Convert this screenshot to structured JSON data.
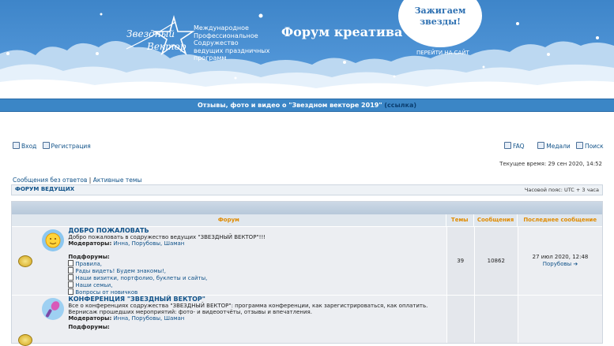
{
  "header": {
    "logo_line1": "Звездный",
    "logo_line2": "Вектор",
    "org_lines": [
      "Международное",
      "Профессиональное",
      "Содружество",
      "ведущих праздничных",
      "программ"
    ],
    "forum_title": "Форум креатива",
    "bubble_line1": "Зажигаем",
    "bubble_line2": "звезды!",
    "goto_site": "ПЕРЕЙТИ НА САЙТ"
  },
  "announcement": {
    "text": "Отзывы, фото и видео о \"Звездном векторе 2019\"",
    "link": "(ссылка)"
  },
  "nav": {
    "login": "Вход",
    "register": "Регистрация",
    "faq": "FAQ",
    "medals": "Медали",
    "search": "Поиск"
  },
  "current_time": "Текущее время: 29 сен 2020, 14:52",
  "links": {
    "unanswered": "Сообщения без ответов",
    "sep": "|",
    "active": "Активные темы"
  },
  "breadcrumb": {
    "forum": "ФОРУМ ВЕДУЩИХ",
    "timezone": "Часовой пояс: UTC + 3 часа"
  },
  "table": {
    "headers": {
      "forum": "Форум",
      "topics": "Темы",
      "posts": "Сообщения",
      "last": "Последнее сообщение"
    },
    "rows": [
      {
        "title": "ДОБРО ПОЖАЛОВАТЬ",
        "desc": "Добро пожаловать в содружество ведущих \"ЗВЕЗДНЫЙ ВЕКТОР\"!!!",
        "mods_label": "Модераторы:",
        "mods": "Инна, Порубовы, Шаман",
        "subforums_label": "Подфорумы:",
        "subforums": [
          "Правила,",
          "Рады видеть! Будем знакомы!,",
          "Наши визитки, портфолио, буклеты и сайты,",
          "Наши семьи,",
          "Вопросы от новичков"
        ],
        "topics": "39",
        "posts": "10862",
        "last_date": "27 июл 2020, 12:48",
        "last_author": "Порубовы"
      },
      {
        "title": "КОНФЕРЕНЦИЯ \"ЗВЕЗДНЫЙ ВЕКТОР\"",
        "desc": "Все о конференциях содружества \"ЗВЕЗДНЫЙ ВЕКТОР\": программа конференции, как зарегистрироваться, как оплатить. Вернисаж прошедших мероприятий: фото- и видеоотчёты, отзывы и впечатления.",
        "mods_label": "Модераторы:",
        "mods": "Инна, Порубовы, Шаман",
        "subforums_label": "Подфорумы:"
      }
    ]
  },
  "colors": {
    "banner": "#4f94d6",
    "announce_bar": "#3b86c6",
    "link": "#105289",
    "header_text": "#e08b00"
  }
}
